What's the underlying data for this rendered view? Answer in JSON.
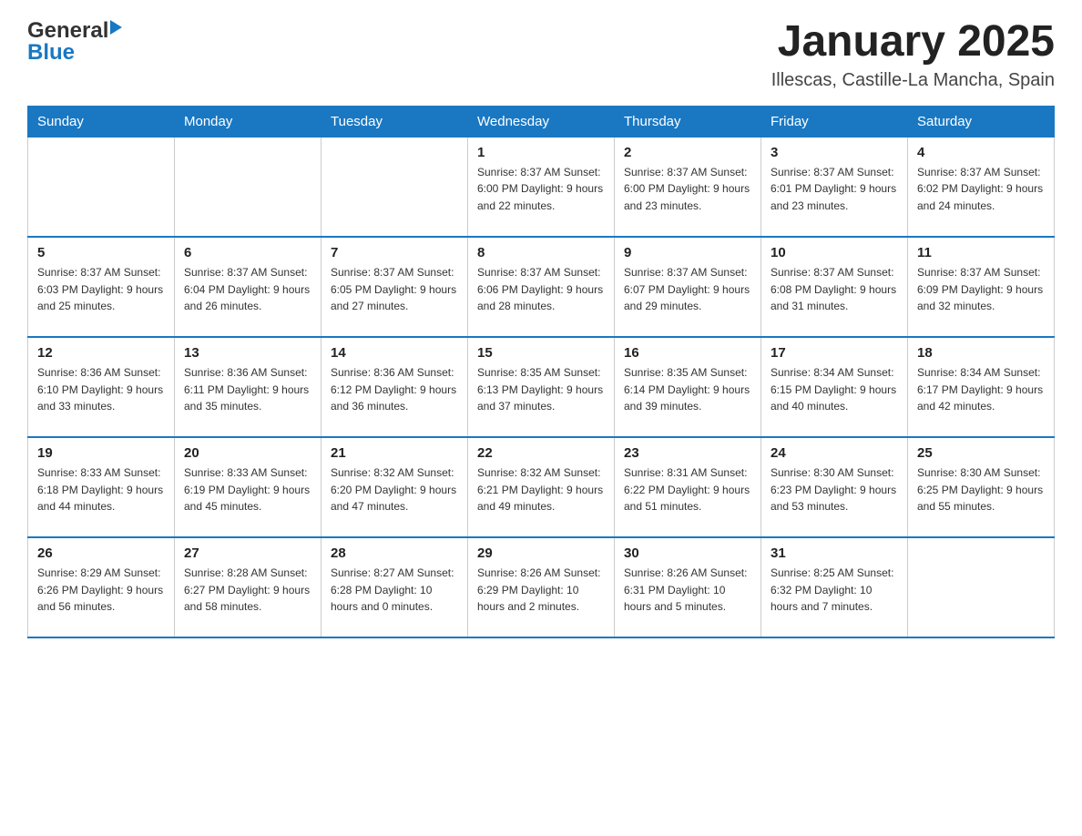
{
  "header": {
    "logo": {
      "general": "General",
      "blue": "Blue"
    },
    "title": "January 2025",
    "location": "Illescas, Castille-La Mancha, Spain"
  },
  "calendar": {
    "days_of_week": [
      "Sunday",
      "Monday",
      "Tuesday",
      "Wednesday",
      "Thursday",
      "Friday",
      "Saturday"
    ],
    "weeks": [
      [
        {
          "day": "",
          "info": ""
        },
        {
          "day": "",
          "info": ""
        },
        {
          "day": "",
          "info": ""
        },
        {
          "day": "1",
          "info": "Sunrise: 8:37 AM\nSunset: 6:00 PM\nDaylight: 9 hours\nand 22 minutes."
        },
        {
          "day": "2",
          "info": "Sunrise: 8:37 AM\nSunset: 6:00 PM\nDaylight: 9 hours\nand 23 minutes."
        },
        {
          "day": "3",
          "info": "Sunrise: 8:37 AM\nSunset: 6:01 PM\nDaylight: 9 hours\nand 23 minutes."
        },
        {
          "day": "4",
          "info": "Sunrise: 8:37 AM\nSunset: 6:02 PM\nDaylight: 9 hours\nand 24 minutes."
        }
      ],
      [
        {
          "day": "5",
          "info": "Sunrise: 8:37 AM\nSunset: 6:03 PM\nDaylight: 9 hours\nand 25 minutes."
        },
        {
          "day": "6",
          "info": "Sunrise: 8:37 AM\nSunset: 6:04 PM\nDaylight: 9 hours\nand 26 minutes."
        },
        {
          "day": "7",
          "info": "Sunrise: 8:37 AM\nSunset: 6:05 PM\nDaylight: 9 hours\nand 27 minutes."
        },
        {
          "day": "8",
          "info": "Sunrise: 8:37 AM\nSunset: 6:06 PM\nDaylight: 9 hours\nand 28 minutes."
        },
        {
          "day": "9",
          "info": "Sunrise: 8:37 AM\nSunset: 6:07 PM\nDaylight: 9 hours\nand 29 minutes."
        },
        {
          "day": "10",
          "info": "Sunrise: 8:37 AM\nSunset: 6:08 PM\nDaylight: 9 hours\nand 31 minutes."
        },
        {
          "day": "11",
          "info": "Sunrise: 8:37 AM\nSunset: 6:09 PM\nDaylight: 9 hours\nand 32 minutes."
        }
      ],
      [
        {
          "day": "12",
          "info": "Sunrise: 8:36 AM\nSunset: 6:10 PM\nDaylight: 9 hours\nand 33 minutes."
        },
        {
          "day": "13",
          "info": "Sunrise: 8:36 AM\nSunset: 6:11 PM\nDaylight: 9 hours\nand 35 minutes."
        },
        {
          "day": "14",
          "info": "Sunrise: 8:36 AM\nSunset: 6:12 PM\nDaylight: 9 hours\nand 36 minutes."
        },
        {
          "day": "15",
          "info": "Sunrise: 8:35 AM\nSunset: 6:13 PM\nDaylight: 9 hours\nand 37 minutes."
        },
        {
          "day": "16",
          "info": "Sunrise: 8:35 AM\nSunset: 6:14 PM\nDaylight: 9 hours\nand 39 minutes."
        },
        {
          "day": "17",
          "info": "Sunrise: 8:34 AM\nSunset: 6:15 PM\nDaylight: 9 hours\nand 40 minutes."
        },
        {
          "day": "18",
          "info": "Sunrise: 8:34 AM\nSunset: 6:17 PM\nDaylight: 9 hours\nand 42 minutes."
        }
      ],
      [
        {
          "day": "19",
          "info": "Sunrise: 8:33 AM\nSunset: 6:18 PM\nDaylight: 9 hours\nand 44 minutes."
        },
        {
          "day": "20",
          "info": "Sunrise: 8:33 AM\nSunset: 6:19 PM\nDaylight: 9 hours\nand 45 minutes."
        },
        {
          "day": "21",
          "info": "Sunrise: 8:32 AM\nSunset: 6:20 PM\nDaylight: 9 hours\nand 47 minutes."
        },
        {
          "day": "22",
          "info": "Sunrise: 8:32 AM\nSunset: 6:21 PM\nDaylight: 9 hours\nand 49 minutes."
        },
        {
          "day": "23",
          "info": "Sunrise: 8:31 AM\nSunset: 6:22 PM\nDaylight: 9 hours\nand 51 minutes."
        },
        {
          "day": "24",
          "info": "Sunrise: 8:30 AM\nSunset: 6:23 PM\nDaylight: 9 hours\nand 53 minutes."
        },
        {
          "day": "25",
          "info": "Sunrise: 8:30 AM\nSunset: 6:25 PM\nDaylight: 9 hours\nand 55 minutes."
        }
      ],
      [
        {
          "day": "26",
          "info": "Sunrise: 8:29 AM\nSunset: 6:26 PM\nDaylight: 9 hours\nand 56 minutes."
        },
        {
          "day": "27",
          "info": "Sunrise: 8:28 AM\nSunset: 6:27 PM\nDaylight: 9 hours\nand 58 minutes."
        },
        {
          "day": "28",
          "info": "Sunrise: 8:27 AM\nSunset: 6:28 PM\nDaylight: 10 hours\nand 0 minutes."
        },
        {
          "day": "29",
          "info": "Sunrise: 8:26 AM\nSunset: 6:29 PM\nDaylight: 10 hours\nand 2 minutes."
        },
        {
          "day": "30",
          "info": "Sunrise: 8:26 AM\nSunset: 6:31 PM\nDaylight: 10 hours\nand 5 minutes."
        },
        {
          "day": "31",
          "info": "Sunrise: 8:25 AM\nSunset: 6:32 PM\nDaylight: 10 hours\nand 7 minutes."
        },
        {
          "day": "",
          "info": ""
        }
      ]
    ]
  }
}
